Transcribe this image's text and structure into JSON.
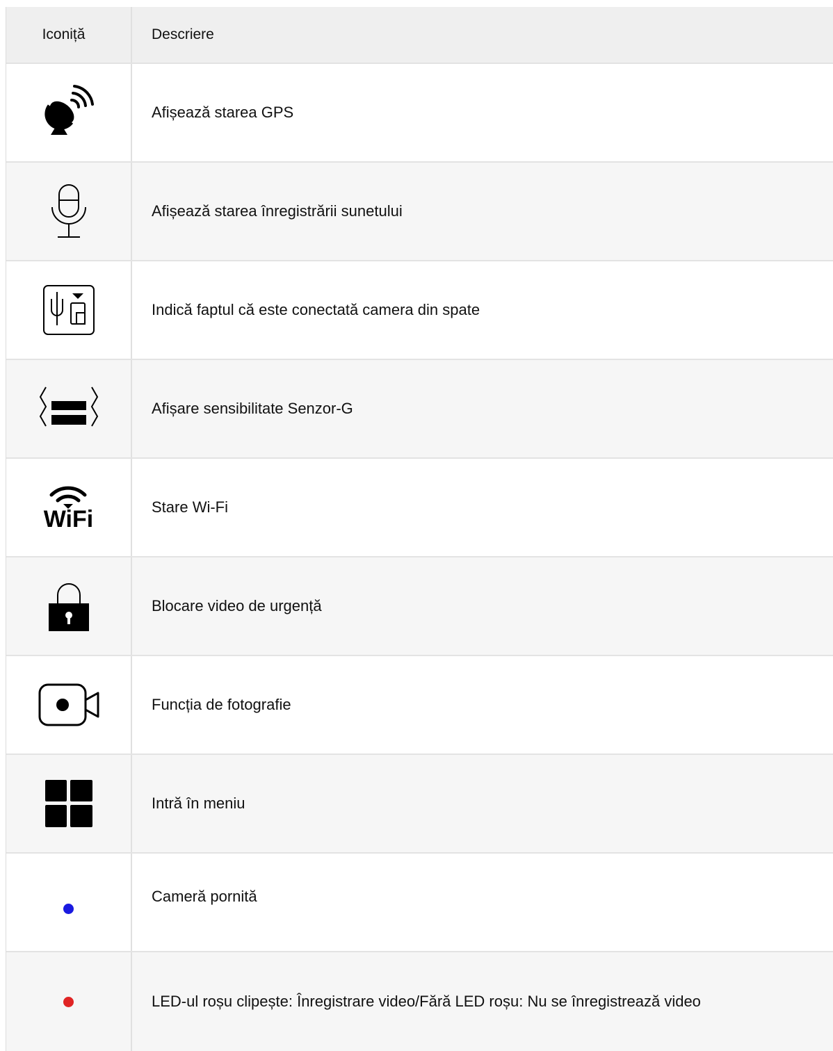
{
  "header": {
    "icon_col": "Iconiță",
    "desc_col": "Descriere"
  },
  "rows": [
    {
      "icon": "satellite-dish-icon",
      "description": "Afișează starea GPS"
    },
    {
      "icon": "microphone-icon",
      "description": "Afișează starea înregistrării sunetului"
    },
    {
      "icon": "rear-camera-icon",
      "description": "Indică faptul că este conectată camera din spate"
    },
    {
      "icon": "g-sensor-icon",
      "description": "Afișare sensibilitate Senzor-G"
    },
    {
      "icon": "wifi-icon",
      "icon_text": "WiFi",
      "description": "Stare Wi-Fi"
    },
    {
      "icon": "lock-icon",
      "description": "Blocare video de urgență"
    },
    {
      "icon": "video-camera-icon",
      "description": "Funcția de fotografie"
    },
    {
      "icon": "menu-grid-icon",
      "description": "Intră în meniu"
    },
    {
      "icon": "blue-dot-icon",
      "color": "#1a1ae0",
      "description": "Cameră pornită"
    },
    {
      "icon": "red-dot-icon",
      "color": "#e02424",
      "description": "LED-ul roșu clipește: Înregistrare video/Fără LED roșu: Nu se înregistrează video"
    }
  ]
}
